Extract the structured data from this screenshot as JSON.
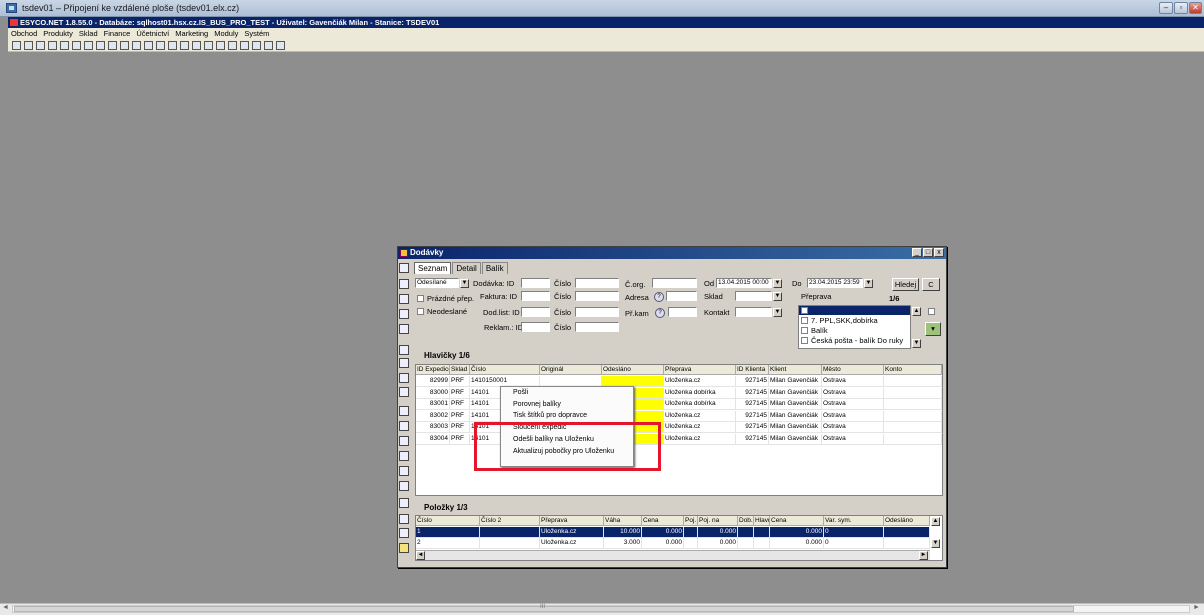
{
  "rdp": {
    "title": "tsdev01 – Připojení ke vzdálené ploše (tsdev01.elx.cz)"
  },
  "app": {
    "title": "ESYCO.NET 1.8.55.0 - Databáze: sqlhost01.hsx.cz.IS_BUS_PRO_TEST - Uživatel: Gavenčiák Milan - Stanice: TSDEV01",
    "menu": [
      "Obchod",
      "Produkty",
      "Sklad",
      "Finance",
      "Účetnictví",
      "Marketing",
      "Moduly",
      "Systém"
    ]
  },
  "window": {
    "title": "Dodávky",
    "tabs": [
      "Seznam",
      "Detail",
      "Balík"
    ],
    "filter": {
      "status": "Odesílané",
      "checks": [
        "Prázdné přep.",
        "Neodeslané"
      ],
      "labels": {
        "dodavka": "Dodávka: ID",
        "faktura": "Faktura: ID",
        "dodlist": "Dod.list: ID",
        "reklam": "Reklam.: ID",
        "cislo": "Číslo",
        "corg": "Č.org.",
        "adresa": "Adresa",
        "prkam": "Př.kam",
        "sklad": "Sklad",
        "kontakt": "Kontakt",
        "od": "Od",
        "do": "Do",
        "preprava": "Přeprava",
        "count": "1/6"
      },
      "od_value": "13.04.2015 00:00",
      "do_value": "23.04.2015 23:59",
      "hledej": "Hledej",
      "c": "C",
      "preprava_list": [
        "7. PPL,SKK,dobírka",
        "Balík",
        "Česká pošta - balík Do ruky"
      ]
    },
    "headers_section": {
      "title": "Hlavičky 1/6",
      "columns": [
        "ID Expedice",
        "Sklad",
        "Číslo",
        "Originál",
        "Odesláno",
        "Přeprava",
        "ID Klienta",
        "Klient",
        "Město",
        "Konto"
      ],
      "rows": [
        [
          "82999",
          "PRF",
          "1410150001",
          "",
          "",
          "Uloženka.cz",
          "927145",
          "Milan Gavenčiák",
          "Ostrava",
          ""
        ],
        [
          "83000",
          "PRF",
          "14101",
          "",
          "",
          "Uloženka dobírka",
          "927145",
          "Milan Gavenčiák",
          "Ostrava",
          ""
        ],
        [
          "83001",
          "PRF",
          "14101",
          "",
          "",
          "Uloženka dobírka",
          "927145",
          "Milan Gavenčiák",
          "Ostrava",
          ""
        ],
        [
          "83002",
          "PRF",
          "14101",
          "",
          "",
          "Uloženka.cz",
          "927145",
          "Milan Gavenčiák",
          "Ostrava",
          ""
        ],
        [
          "83003",
          "PRF",
          "14101",
          "",
          "",
          "Uloženka.cz",
          "927145",
          "Milan Gavenčiák",
          "Ostrava",
          ""
        ],
        [
          "83004",
          "PRF",
          "14101",
          "",
          "",
          "Uloženka.cz",
          "927145",
          "Milan Gavenčiák",
          "Ostrava",
          ""
        ]
      ]
    },
    "context_menu": [
      "Pošli",
      "Porovnej balíky",
      "Tisk štítků pro dopravce",
      "Sloučení expedic",
      "Odešli balíky na Uloženku",
      "Aktualizuj pobočky pro Uloženku"
    ],
    "items_section": {
      "title": "Položky 1/3",
      "columns": [
        "Číslo",
        "Číslo 2",
        "Přeprava",
        "Váha",
        "Cena",
        "Poj.",
        "Poj. na",
        "Dob.",
        "Hlavní",
        "Cena",
        "Var. sym.",
        "Odesláno"
      ],
      "rows": [
        [
          "1",
          "",
          "Uloženka.cz",
          "10.000",
          "0.000",
          "",
          "0.000",
          "",
          "",
          "0.000",
          "0",
          ""
        ],
        [
          "2",
          "",
          "Uloženka.cz",
          "3.000",
          "0.000",
          "",
          "0.000",
          "",
          "",
          "0.000",
          "0",
          ""
        ]
      ]
    }
  },
  "colors": {
    "selection": "#0a246a",
    "highlight_yellow": "#ffff00",
    "annotation_red": "#e3172b"
  },
  "scroll_grip": "III"
}
